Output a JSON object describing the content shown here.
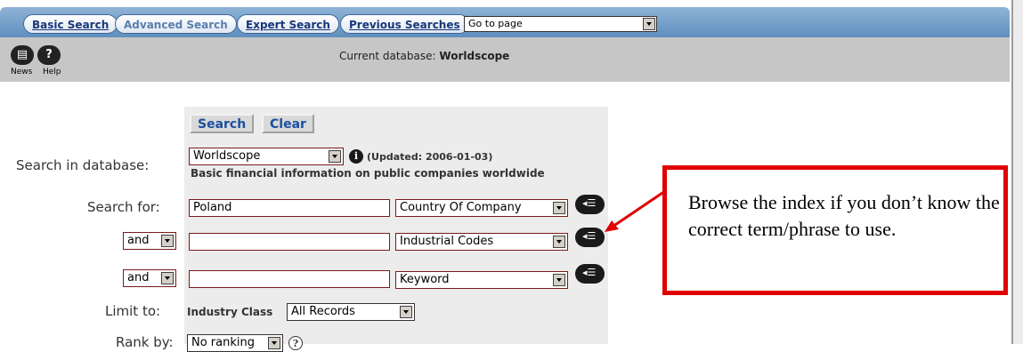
{
  "tabs": [
    {
      "label": "Basic Search"
    },
    {
      "label": "Advanced Search"
    },
    {
      "label": "Expert Search"
    },
    {
      "label": "Previous Searches"
    }
  ],
  "goto_select": {
    "value": "Go to page"
  },
  "toolbar": {
    "news_label": "News",
    "help_label": "Help",
    "current_db_label": "Current database:",
    "current_db_value": "Worldscope"
  },
  "form": {
    "search_button": "Search",
    "clear_button": "Clear",
    "db_label": "Search in database:",
    "db_select": "Worldscope",
    "db_updated": "(Updated: 2006-01-03)",
    "db_description": "Basic financial information on public companies worldwide",
    "search_for_label": "Search for:",
    "rows": [
      {
        "operator": "",
        "term": "Poland",
        "field": "Country Of Company"
      },
      {
        "operator": "and",
        "term": "",
        "field": "Industrial Codes"
      },
      {
        "operator": "and",
        "term": "",
        "field": "Keyword"
      }
    ],
    "limit_label": "Limit to:",
    "industry_class_label": "Industry Class",
    "industry_class_value": "All Records",
    "rank_label": "Rank by:",
    "rank_value": "No ranking"
  },
  "callout": {
    "text": "Browse the index if you don’t know the correct term/phrase to use.",
    "color": "#e00000"
  }
}
